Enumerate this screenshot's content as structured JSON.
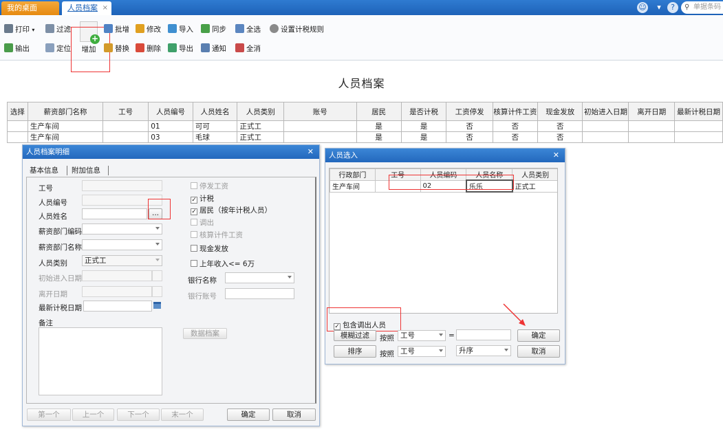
{
  "tabs": {
    "desktop": "我的桌面",
    "current": "人员档案",
    "close": "×"
  },
  "search_placeholder": "单据条码",
  "toolbar": {
    "print": "打印",
    "filter": "过滤",
    "add": "增加",
    "batch_add": "批增",
    "modify": "修改",
    "import": "导入",
    "sync": "同步",
    "select_all": "全选",
    "tax_rule": "设置计税规则",
    "output": "输出",
    "locate": "定位",
    "replace": "替换",
    "delete": "删除",
    "export": "导出",
    "notify": "通知",
    "deselect_all": "全消"
  },
  "page_title": "人员档案",
  "main_table": {
    "headers": [
      "选择",
      "薪资部门名称",
      "工号",
      "人员编号",
      "人员姓名",
      "人员类别",
      "账号",
      "居民",
      "是否计税",
      "工资停发",
      "核算计件工资",
      "现金发放",
      "初始进入日期",
      "离开日期",
      "最新计税日期"
    ],
    "rows": [
      [
        "",
        "生产车间",
        "",
        "01",
        "可可",
        "正式工",
        "",
        "是",
        "是",
        "否",
        "否",
        "否",
        "",
        "",
        ""
      ],
      [
        "",
        "生产车间",
        "",
        "03",
        "毛球",
        "正式工",
        "",
        "是",
        "是",
        "否",
        "否",
        "否",
        "",
        "",
        ""
      ]
    ]
  },
  "detail_dialog": {
    "title": "人员档案明细",
    "tabs": [
      "基本信息",
      "附加信息"
    ],
    "labels": {
      "job_no": "工号",
      "person_code": "人员编号",
      "person_name": "人员姓名",
      "dept_code": "薪资部门编码",
      "dept_name": "薪资部门名称",
      "category": "人员类别",
      "start_date": "初始进入日期",
      "leave_date": "离开日期",
      "tax_date": "最新计税日期",
      "remark": "备注",
      "bank_name": "银行名称",
      "bank_account": "银行账号"
    },
    "category_value": "正式工",
    "ellipsis": "...",
    "checkboxes": {
      "stop_pay": "停发工资",
      "taxable": "计税",
      "resident": "居民（按年计税人员）",
      "transfer_out": "调出",
      "piece_wage": "核算计件工资",
      "cash": "现金发放",
      "income": "上年收入<= 6万"
    },
    "data_archive_btn": "数据档案",
    "nav": {
      "first": "第一个",
      "prev": "上一个",
      "next": "下一个",
      "last": "末一个"
    },
    "ok": "确定",
    "cancel": "取消"
  },
  "select_dialog": {
    "title": "人员选入",
    "headers": [
      "行政部门",
      "工号",
      "人员编码",
      "人员名称",
      "人员类别"
    ],
    "rows": [
      [
        "生产车间",
        "",
        "02",
        "乐乐",
        "正式工"
      ]
    ],
    "include_transfer": "包含调出人员",
    "fuzzy_filter": "模糊过滤",
    "sort": "排序",
    "by": "按照",
    "field1": "工号",
    "field2": "工号",
    "equals": "=",
    "order": "升序",
    "ok": "确定",
    "cancel": "取消"
  }
}
